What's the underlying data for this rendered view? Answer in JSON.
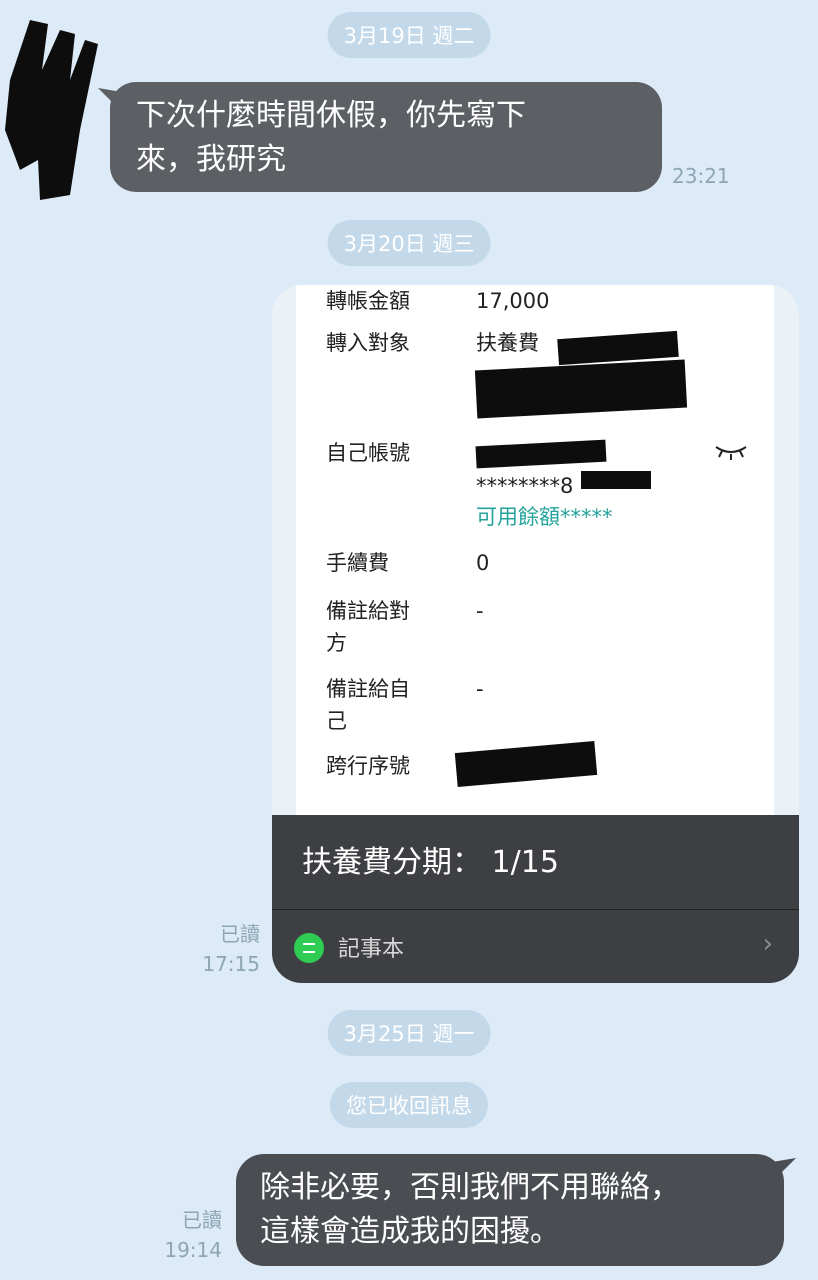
{
  "dates": {
    "d1": "3月19日 週二",
    "d2": "3月20日 週三",
    "d3": "3月25日 週一",
    "recalled": "您已收回訊息"
  },
  "messages": {
    "m1": {
      "line1": "下次什麼時間休假，你先寫下",
      "line2": "來，我研究",
      "time": "23:21"
    },
    "card": {
      "rows": [
        {
          "label": "轉帳金額",
          "value": "17,000"
        },
        {
          "label": "轉入對象",
          "value": "扶養費"
        },
        {
          "label": "自己帳號",
          "value": "********8"
        },
        {
          "label": "手續費",
          "value": "0"
        },
        {
          "label": "備註給對方",
          "value": "-"
        },
        {
          "label": "備註給自己",
          "value": "-"
        },
        {
          "label": "跨行序號",
          "value": ""
        }
      ],
      "available": "可用餘額*****",
      "note_title": "扶養費分期： 1/15",
      "note_label": "記事本",
      "read": "已讀",
      "time": "17:15"
    },
    "m3": {
      "line1": "除非必要，否則我們不用聯絡，",
      "line2": "這樣會造成我的困擾。",
      "read": "已讀",
      "time": "19:14"
    }
  },
  "icons": {
    "eye": "eye-closed-icon",
    "note": "notebook-icon",
    "chevron": "chevron-right-icon"
  },
  "colors": {
    "background": "#dcebf7",
    "bubble": "#5c5f63",
    "teal": "#24a39a",
    "note_green": "#2ecc52"
  }
}
